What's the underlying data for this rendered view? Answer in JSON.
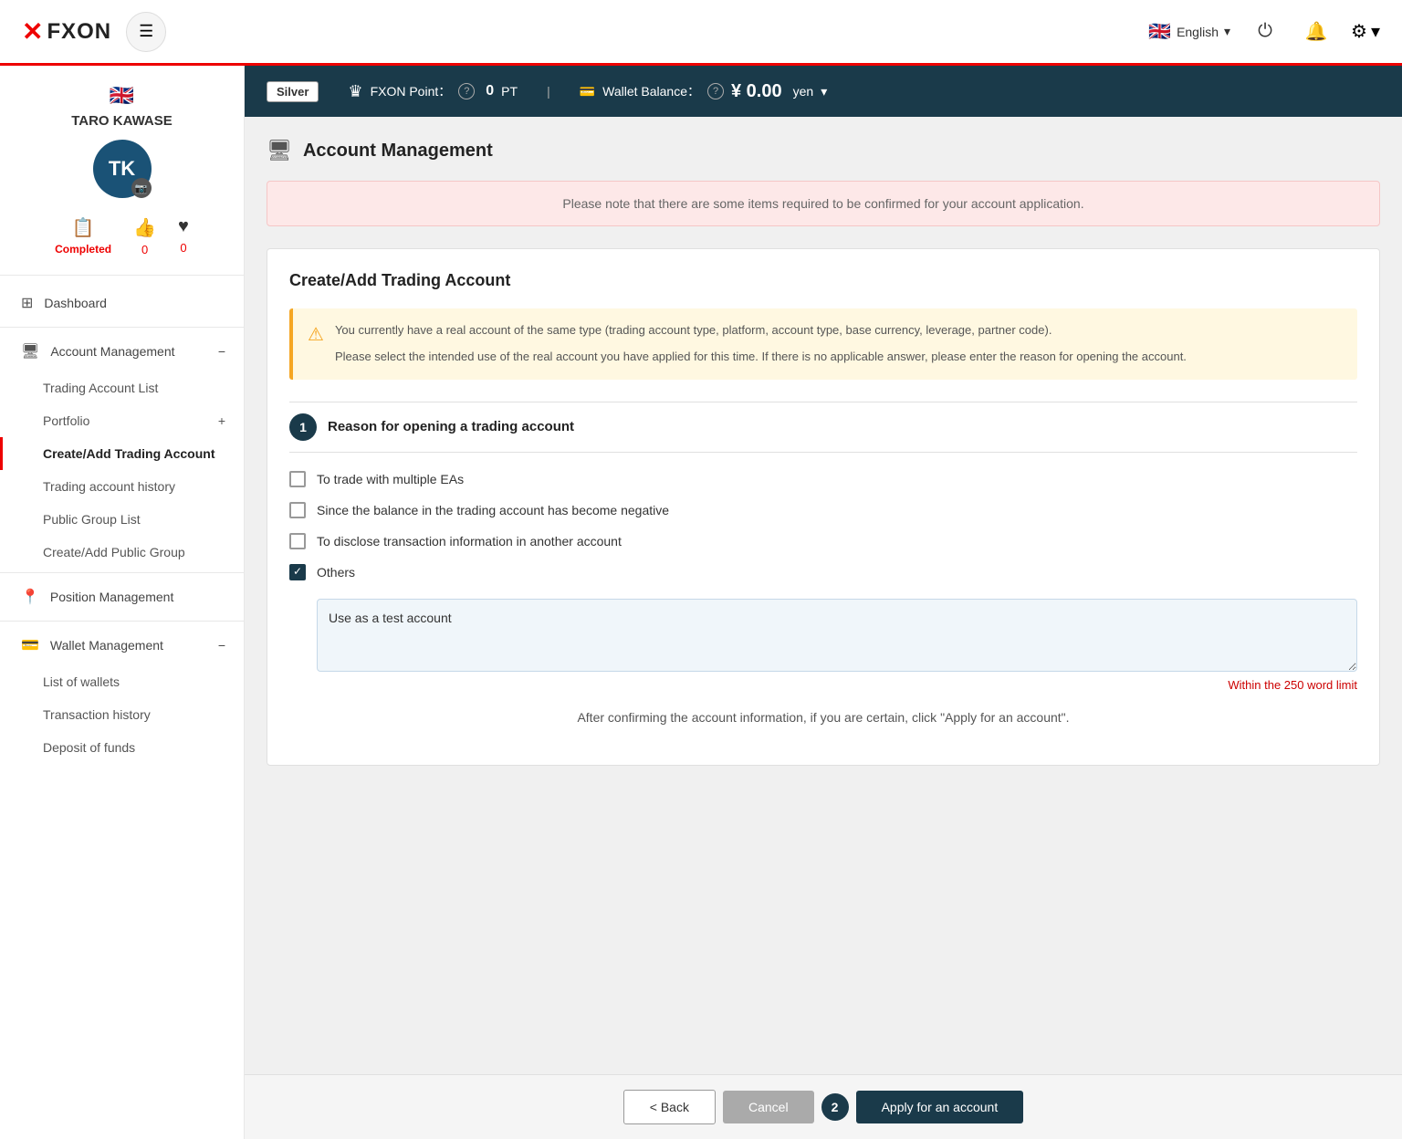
{
  "topNav": {
    "logoX": "✕",
    "logoText": "FXON",
    "hamburgerLabel": "☰",
    "language": {
      "flag": "🇬🇧",
      "label": "English",
      "chevron": "▾"
    },
    "powerIcon": "⏻",
    "bellIcon": "🔔",
    "gearIcon": "⚙",
    "gearChevron": "▾"
  },
  "headerBar": {
    "silverBadge": "Silver",
    "fxonPointLabel": "FXON Point：",
    "fxonPointHelp": "?",
    "fxonPointValue": "0",
    "fxonPointUnit": "PT",
    "walletBalanceLabel": "Wallet Balance：",
    "walletBalanceHelp": "?",
    "walletIcon": "💳",
    "walletCrownIcon": "♛",
    "walletValue": "¥ 0.00",
    "walletUnit": "yen",
    "walletChevron": "▾"
  },
  "sidebar": {
    "userFlag": "🇬🇧",
    "userName": "TARO KAWASE",
    "avatarInitials": "TK",
    "cameraIcon": "📷",
    "stats": [
      {
        "icon": "📋",
        "label": "Completed",
        "value": ""
      },
      {
        "icon": "👍",
        "value": "0"
      },
      {
        "icon": "♥",
        "value": "0"
      }
    ],
    "navItems": [
      {
        "id": "dashboard",
        "icon": "⊞",
        "label": "Dashboard",
        "expandable": false
      },
      {
        "id": "account-management",
        "icon": "🖥",
        "label": "Account Management",
        "expandable": true,
        "expanded": true
      },
      {
        "id": "position-management",
        "icon": "📍",
        "label": "Position Management",
        "expandable": false
      },
      {
        "id": "wallet-management",
        "icon": "💳",
        "label": "Wallet Management",
        "expandable": true,
        "expanded": true
      }
    ],
    "accountSubItems": [
      {
        "id": "trading-account-list",
        "label": "Trading Account List",
        "active": false
      },
      {
        "id": "portfolio",
        "label": "Portfolio",
        "active": false,
        "expandable": true
      },
      {
        "id": "create-add-trading-account",
        "label": "Create/Add Trading Account",
        "active": true
      },
      {
        "id": "trading-account-history",
        "label": "Trading account history",
        "active": false
      },
      {
        "id": "public-group-list",
        "label": "Public Group List",
        "active": false
      },
      {
        "id": "create-add-public-group",
        "label": "Create/Add Public Group",
        "active": false
      }
    ],
    "walletSubItems": [
      {
        "id": "list-of-wallets",
        "label": "List of wallets",
        "active": false
      },
      {
        "id": "transaction-history",
        "label": "Transaction history",
        "active": false
      },
      {
        "id": "deposit-of-funds",
        "label": "Deposit of funds",
        "active": false
      }
    ]
  },
  "pageTitle": {
    "icon": "🖥",
    "title": "Account Management"
  },
  "alertBanner": {
    "text": "Please note that there are some items required to be confirmed for your account application."
  },
  "sectionTitle": "Create/Add Trading Account",
  "warningBox": {
    "icon": "⚠",
    "line1": "You currently have a real account of the same type (trading account type, platform, account type, base currency, leverage, partner code).",
    "line2": "Please select the intended use of the real account you have applied for this time. If there is no applicable answer, please enter the reason for opening the account."
  },
  "step1": {
    "badge": "1",
    "title": "Reason for opening a trading account"
  },
  "checkboxOptions": [
    {
      "id": "opt1",
      "label": "To trade with multiple EAs",
      "checked": false
    },
    {
      "id": "opt2",
      "label": "Since the balance in the trading account has become negative",
      "checked": false
    },
    {
      "id": "opt3",
      "label": "To disclose transaction information in another account",
      "checked": false
    },
    {
      "id": "opt4",
      "label": "Others",
      "checked": true
    }
  ],
  "textareaValue": "Use as a test account",
  "wordLimit": "Within the 250 word limit",
  "confirmText": "After confirming the account information, if you are certain, click \"Apply for an account\".",
  "buttons": {
    "back": "< Back",
    "cancel": "Cancel",
    "step2Badge": "2",
    "applyLabel": "Apply for an account"
  }
}
